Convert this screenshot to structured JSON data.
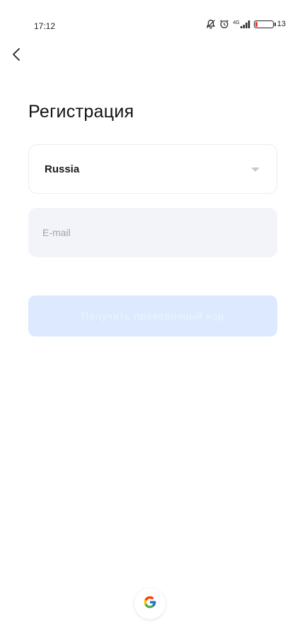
{
  "status_bar": {
    "time": "17:12",
    "network": "4G",
    "battery_percent": "13",
    "battery_level": 0.13,
    "icons": [
      "mute-icon",
      "alarm-icon",
      "signal-icon",
      "battery-icon"
    ]
  },
  "header": {
    "back_icon": "chevron-left-icon",
    "title": "Регистрация"
  },
  "form": {
    "country": {
      "value": "Russia",
      "icon": "caret-down-icon"
    },
    "email": {
      "value": "",
      "placeholder": "E-mail"
    },
    "submit_label": "Получить проверочный код"
  },
  "social": {
    "google_icon": "google-icon"
  },
  "colors": {
    "button_disabled_bg": "#dce9ff",
    "input_bg": "#f3f4f9",
    "battery_low": "#e53935"
  }
}
